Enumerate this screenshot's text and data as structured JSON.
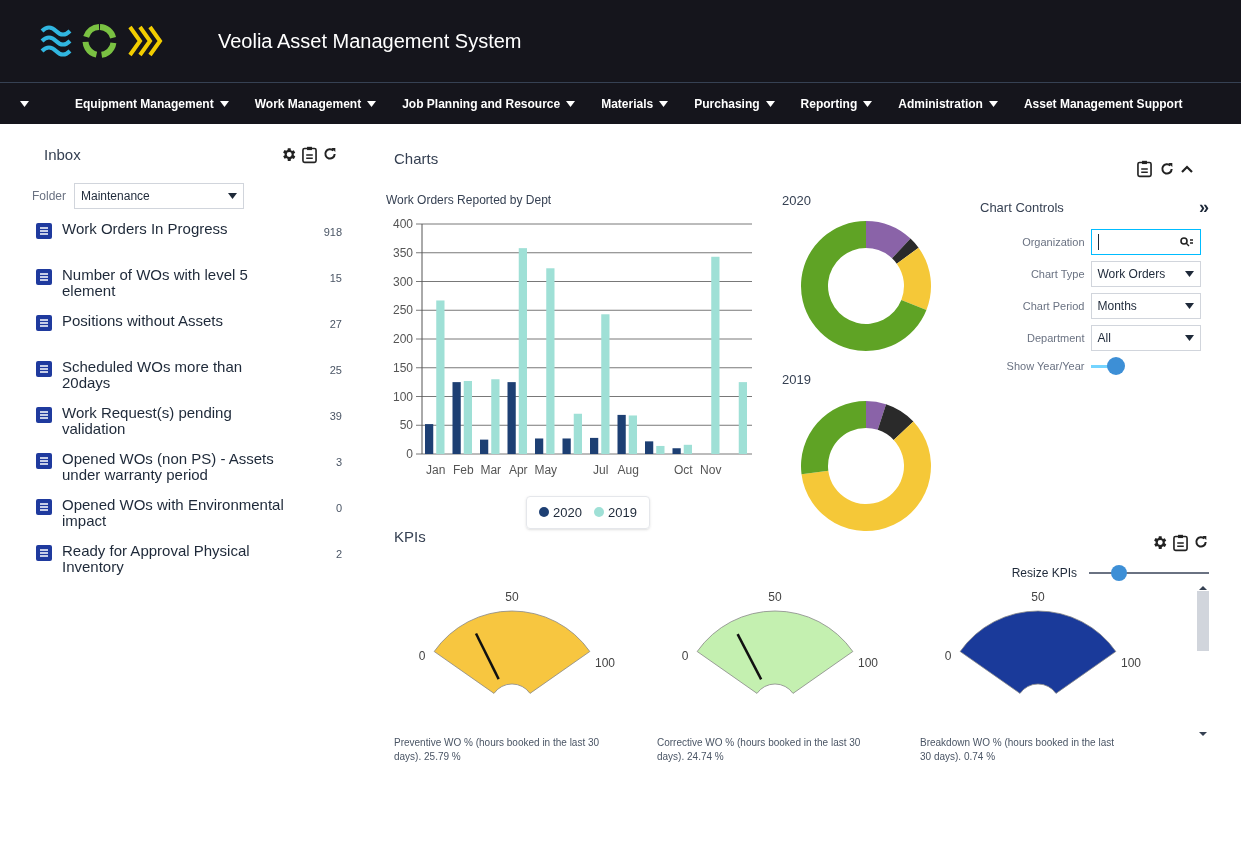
{
  "header": {
    "title": "Veolia Asset Management System"
  },
  "nav": [
    "Equipment Management",
    "Work Management",
    "Job Planning and Resource",
    "Materials",
    "Purchasing",
    "Reporting",
    "Administration",
    "Asset Management Support"
  ],
  "inbox": {
    "title": "Inbox",
    "folder_label": "Folder",
    "folder_value": "Maintenance",
    "items": [
      {
        "label": "Work Orders In Progress",
        "count": "918"
      },
      {
        "label": "Number of WOs with level 5 element",
        "count": "15"
      },
      {
        "label": "Positions without Assets",
        "count": "27"
      },
      {
        "label": "Scheduled WOs more than 20days",
        "count": "25"
      },
      {
        "label": "Work Request(s) pending validation",
        "count": "39"
      },
      {
        "label": "Opened WOs (non PS) - Assets under warranty period",
        "count": "3"
      },
      {
        "label": "Opened WOs with Environmental impact",
        "count": "0"
      },
      {
        "label": "Ready for Approval Physical Inventory",
        "count": "2"
      }
    ]
  },
  "charts": {
    "title": "Charts",
    "chart_data": {
      "type": "bar",
      "title": "Work Orders Reported by Dept",
      "stacked": false,
      "grid": true,
      "legend": "bottom",
      "categories": [
        "Jan",
        "Feb",
        "Mar",
        "Apr",
        "May",
        null,
        "Jul",
        "Aug",
        null,
        "Oct",
        "Nov",
        null
      ],
      "ylim": [
        0,
        400
      ],
      "yticks": [
        0,
        50,
        100,
        150,
        200,
        250,
        300,
        350,
        400
      ],
      "series": [
        {
          "name": "2020",
          "color": "#1d3f73",
          "values": [
            52,
            125,
            25,
            125,
            27,
            27,
            28,
            68,
            22,
            10,
            null,
            null
          ]
        },
        {
          "name": "2019",
          "color": "#9fe0d6",
          "values": [
            267,
            127,
            130,
            358,
            323,
            70,
            243,
            67,
            14,
            16,
            343,
            125
          ]
        }
      ]
    },
    "donuts": [
      {
        "label": "2020"
      },
      {
        "label": "2019"
      }
    ]
  },
  "chart_controls": {
    "title": "Chart Controls",
    "expand_glyph": "»",
    "organization_label": "Organization",
    "chart_type_label": "Chart Type",
    "chart_type_value": "Work Orders",
    "chart_period_label": "Chart Period",
    "chart_period_value": "Months",
    "department_label": "Department",
    "department_value": "All",
    "show_label": "Show Year/Year",
    "show_on": true
  },
  "kpis": {
    "title": "KPIs",
    "resize": {
      "label": "Resize KPIs",
      "level": 0.25
    },
    "gauges": [
      {
        "caption": "Preventive WO % (hours booked in the last 30 days). 25.79 %",
        "color": "#f7c640",
        "scale": [
          "0",
          "50",
          "100"
        ]
      },
      {
        "caption": "Corrective WO % (hours booked in the last 30 days). 24.74 %",
        "color": "#c4f0b0",
        "scale": [
          "0",
          "50",
          "100"
        ]
      },
      {
        "caption": "Breakdown WO % (hours booked in the last 30 days). 0.74 %",
        "color": "#1a3a9a",
        "scale": [
          "0",
          "50",
          "100"
        ]
      }
    ]
  }
}
